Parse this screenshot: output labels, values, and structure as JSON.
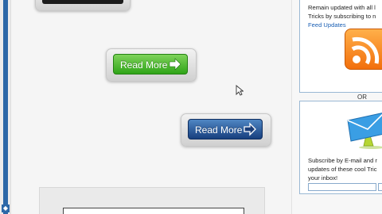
{
  "buttons": {
    "green": {
      "label": "Read More"
    },
    "blue": {
      "label": "Read More"
    }
  },
  "sidebar": {
    "feed_panel": {
      "line1": "Remain updated with all l",
      "line2": "Tricks by subscribing to n",
      "link": "Feed Updates"
    },
    "or_label": "OR",
    "email_panel": {
      "line1": "Subscribe by E-mail and r",
      "line2": "updates of these cool Tric",
      "line3": "your inbox!"
    }
  },
  "icons": [
    "rss-feed-icon",
    "email-envelope-icon",
    "arrow-right-icon",
    "mouse-cursor-icon"
  ],
  "colors": {
    "green_button": "#2fa418",
    "blue_button": "#173f7e",
    "rss_orange": "#f26f0c",
    "link_blue": "#1a5fb4",
    "envelope_blue": "#3a9ee4"
  }
}
